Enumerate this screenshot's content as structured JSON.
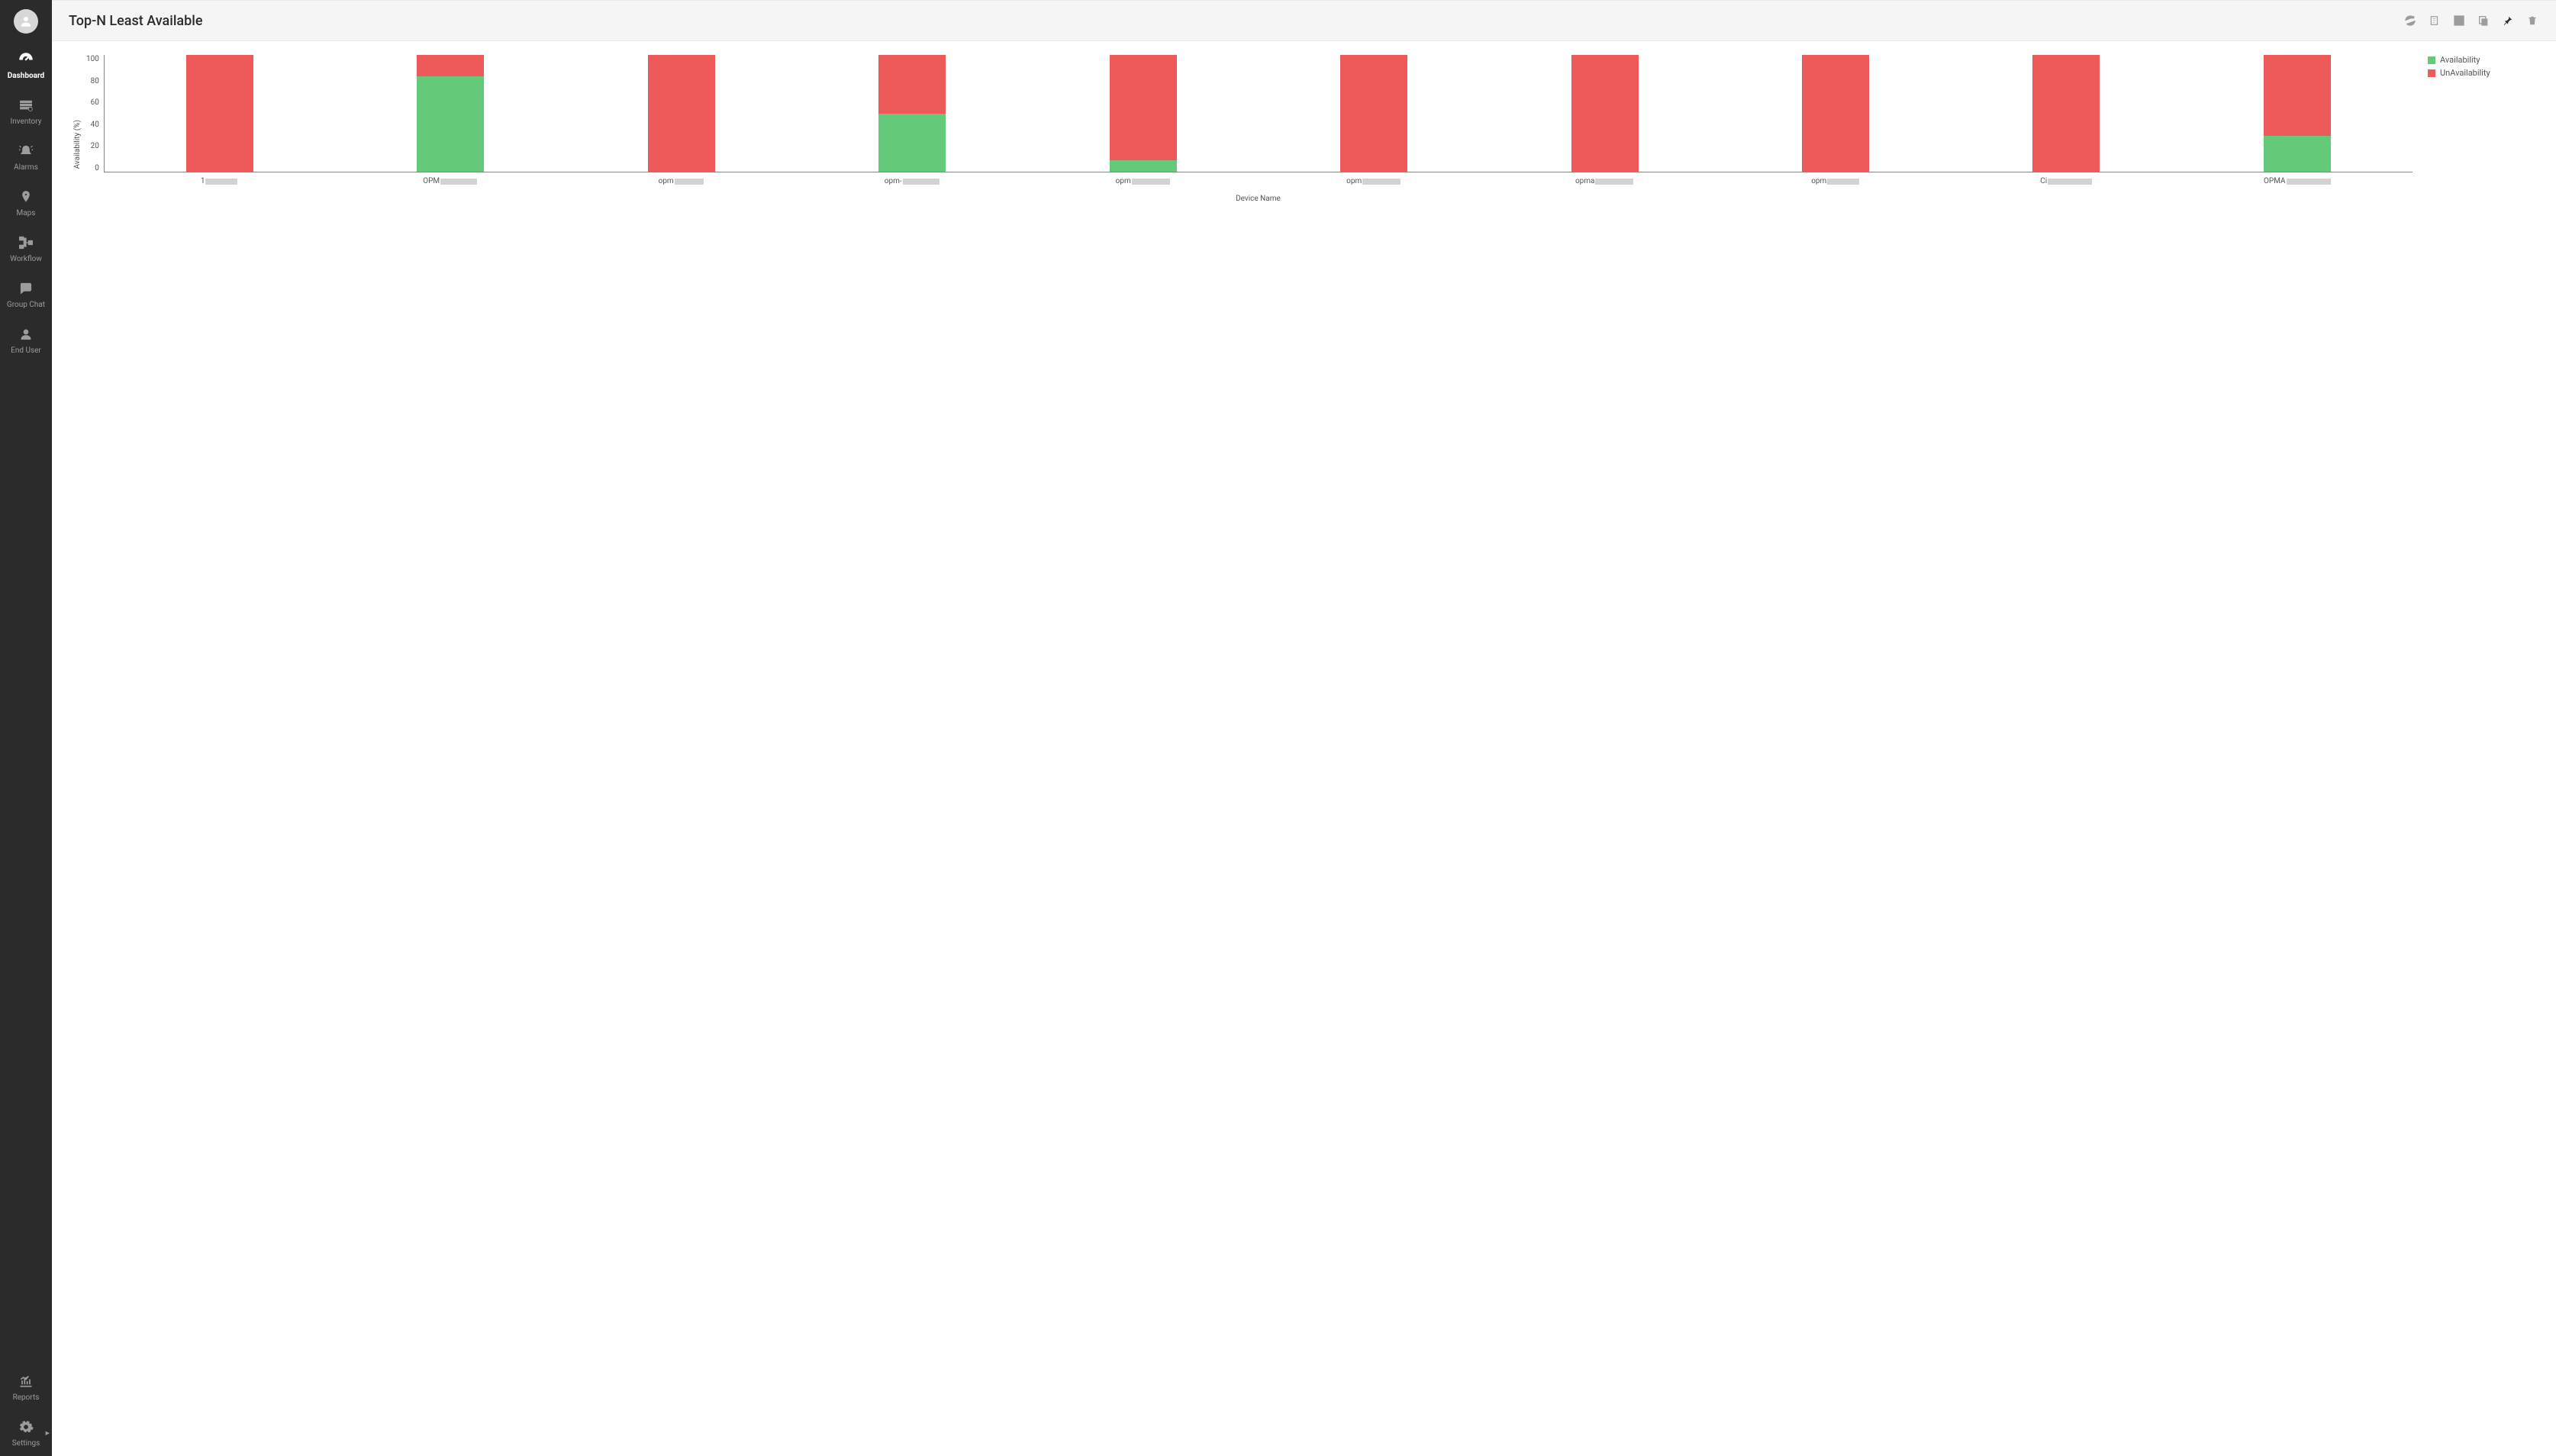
{
  "sidebar": {
    "items": [
      {
        "label": "Dashboard",
        "active": true
      },
      {
        "label": "Inventory",
        "active": false
      },
      {
        "label": "Alarms",
        "active": false
      },
      {
        "label": "Maps",
        "active": false
      },
      {
        "label": "Workflow",
        "active": false
      },
      {
        "label": "Group Chat",
        "active": false
      },
      {
        "label": "End User",
        "active": false
      },
      {
        "label": "Reports",
        "active": false
      },
      {
        "label": "Settings",
        "active": false
      }
    ]
  },
  "header": {
    "title": "Top-N Least Available",
    "actions": [
      "refresh",
      "export",
      "edit",
      "copy",
      "pin",
      "delete"
    ]
  },
  "chart_data": {
    "type": "bar",
    "stacked": true,
    "title": "Top-N Least Available",
    "xlabel": "Device Name",
    "ylabel": "Availability (%)",
    "ylim": [
      0,
      100
    ],
    "yticks": [
      100,
      80,
      60,
      40,
      20,
      0
    ],
    "categories": [
      {
        "prefix": "1",
        "redact_w": 42
      },
      {
        "prefix": "OPM",
        "redact_w": 48
      },
      {
        "prefix": "opm",
        "redact_w": 38
      },
      {
        "prefix": "opm-",
        "redact_w": 48
      },
      {
        "prefix": "opm",
        "redact_w": 50
      },
      {
        "prefix": "opm",
        "redact_w": 50
      },
      {
        "prefix": "opma",
        "redact_w": 50
      },
      {
        "prefix": "opm",
        "redact_w": 42
      },
      {
        "prefix": "Ci",
        "redact_w": 58
      },
      {
        "prefix": "OPMA",
        "redact_w": 58
      }
    ],
    "series": [
      {
        "name": "Availability",
        "color": "#65c97a",
        "values": [
          0,
          82,
          0,
          50,
          10,
          0,
          0,
          0,
          0,
          31
        ]
      },
      {
        "name": "UnAvailability",
        "color": "#ee5a5a",
        "values": [
          100,
          18,
          100,
          50,
          90,
          100,
          100,
          100,
          100,
          69
        ]
      }
    ]
  },
  "colors": {
    "availability": "#65c97a",
    "unavailability": "#ee5a5a",
    "sidebar_bg": "#2b2b2b",
    "header_bg": "#f5f5f5"
  }
}
